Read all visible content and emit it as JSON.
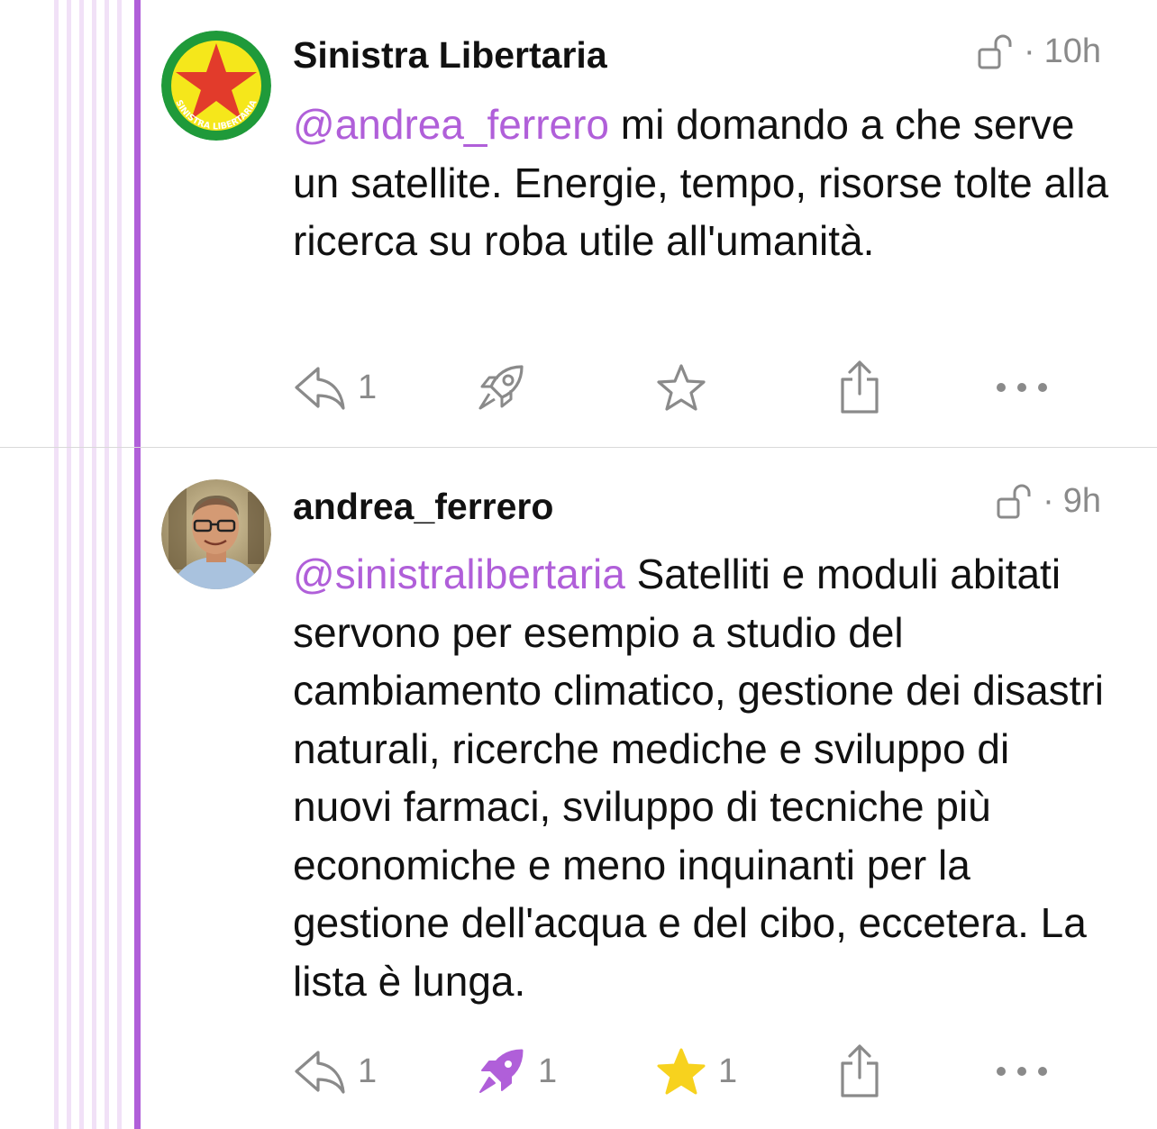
{
  "colors": {
    "accent": "#b05fd9",
    "muted": "#8a8a8a",
    "text": "#111111",
    "star_active": "#f7d21e",
    "guide_light": "#f1e1f7"
  },
  "posts": [
    {
      "author": "Sinistra Libertaria",
      "avatar_text": "SINISTRA LIBERTARIA",
      "visibility_icon": "unlock-icon",
      "separator": "·",
      "time": "10h",
      "mention": "@andrea_ferrero",
      "body": " mi domando a che serve un satellite. Energie, tempo, risorse tolte alla ricerca su roba utile all'umanità.",
      "actions": {
        "reply_count": "1",
        "boost_count": "",
        "fav_count": "",
        "boosted": false,
        "favourited": false
      }
    },
    {
      "author": "andrea_ferrero",
      "visibility_icon": "unlock-icon",
      "separator": "·",
      "time": "9h",
      "mention": "@sinistralibertaria",
      "body": " Satelliti e moduli abitati servono per esempio a studio del cambiamento climatico, gestione dei disastri naturali, ricerche mediche e sviluppo di nuovi farmaci, sviluppo di tecniche più economiche e meno inquinanti per la gestione dell'acqua e del cibo, eccetera. La lista è lunga.",
      "actions": {
        "reply_count": "1",
        "boost_count": "1",
        "fav_count": "1",
        "boosted": true,
        "favourited": true
      }
    }
  ]
}
